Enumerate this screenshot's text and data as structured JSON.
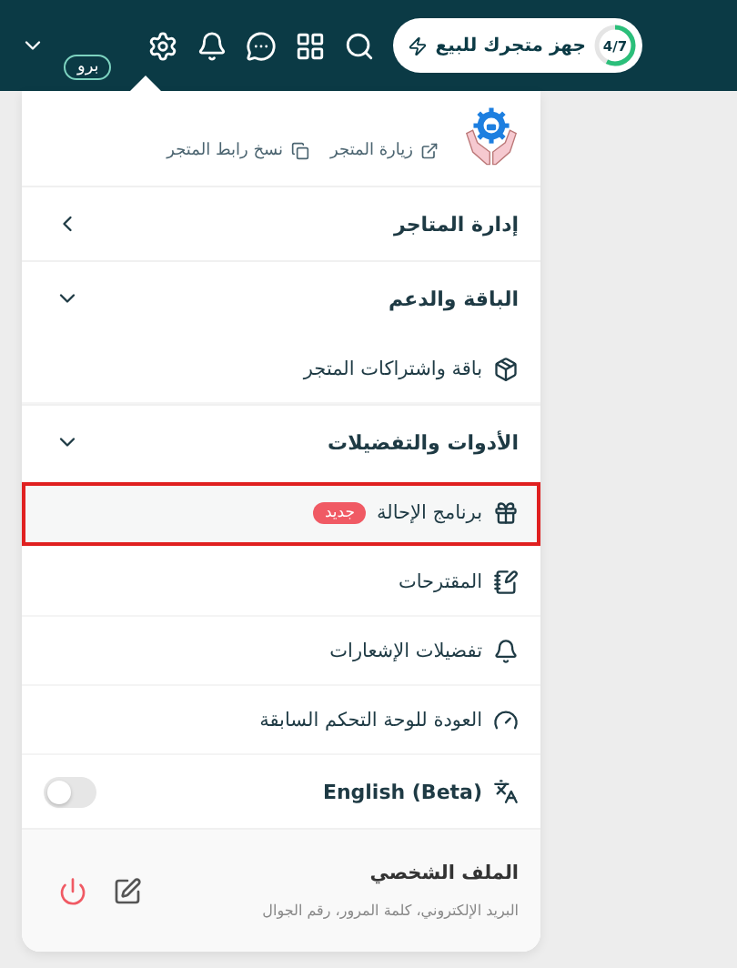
{
  "header": {
    "setup": {
      "progress": "4/7",
      "level": 0.571,
      "label": "جهز متجرك للبيع"
    },
    "plan_badge": "برو"
  },
  "menu": {
    "links": [
      {
        "label": "زيارة المتجر"
      },
      {
        "label": "نسخ رابط المتجر"
      }
    ],
    "sections": [
      {
        "title": "إدارة المتاجر",
        "expanded": false
      },
      {
        "title": "الباقة والدعم",
        "expanded": true,
        "items": [
          {
            "label": "باقة واشتراكات المتجر",
            "highlighted": false
          }
        ]
      },
      {
        "title": "الأدوات والتفضيلات",
        "expanded": true,
        "items": [
          {
            "label": "برنامج الإحالة",
            "badge": "جديد",
            "highlighted": true
          },
          {
            "label": "المقترحات",
            "highlighted": false
          },
          {
            "label": "تفضيلات الإشعارات",
            "highlighted": false
          },
          {
            "label": "العودة للوحة التحكم السابقة",
            "highlighted": false
          }
        ]
      }
    ],
    "language": {
      "label": "English (Beta)",
      "on": false
    },
    "profile": {
      "title": "الملف الشخصي",
      "subtitle": "البريد الإلكتروني، كلمة المرور، رقم الجوال"
    }
  }
}
